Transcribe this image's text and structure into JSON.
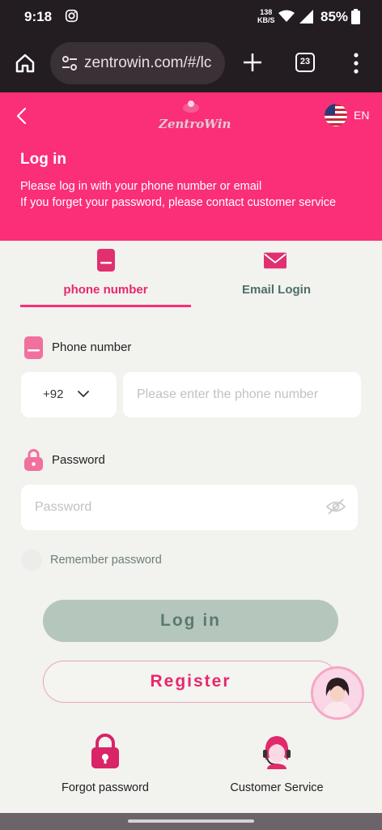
{
  "status_bar": {
    "time": "9:18",
    "speed_value": "138",
    "speed_unit": "KB/S",
    "battery": "85%"
  },
  "browser": {
    "url": "zentrowin.com/#/lc",
    "tab_count": "23"
  },
  "header": {
    "logo_text": "ZentroWin",
    "language": "EN",
    "title": "Log in",
    "description_line1": "Please log in with your phone number or email",
    "description_line2": "If you forget your password, please contact customer service",
    "background_color": "#fb2e78"
  },
  "tabs": [
    {
      "label": "phone number",
      "icon": "phone-icon",
      "active": true
    },
    {
      "label": "Email Login",
      "icon": "envelope-icon",
      "active": false
    }
  ],
  "form": {
    "phone_label": "Phone number",
    "country_code": "+92",
    "phone_placeholder": "Please enter the phone number",
    "password_label": "Password",
    "password_placeholder": "Password",
    "remember_label": "Remember password"
  },
  "buttons": {
    "login": "Log in",
    "register": "Register"
  },
  "bottom": {
    "forgot": "Forgot password",
    "service": "Customer Service"
  },
  "colors": {
    "accent": "#fb2e78",
    "login_button": "#b5c6bd"
  }
}
